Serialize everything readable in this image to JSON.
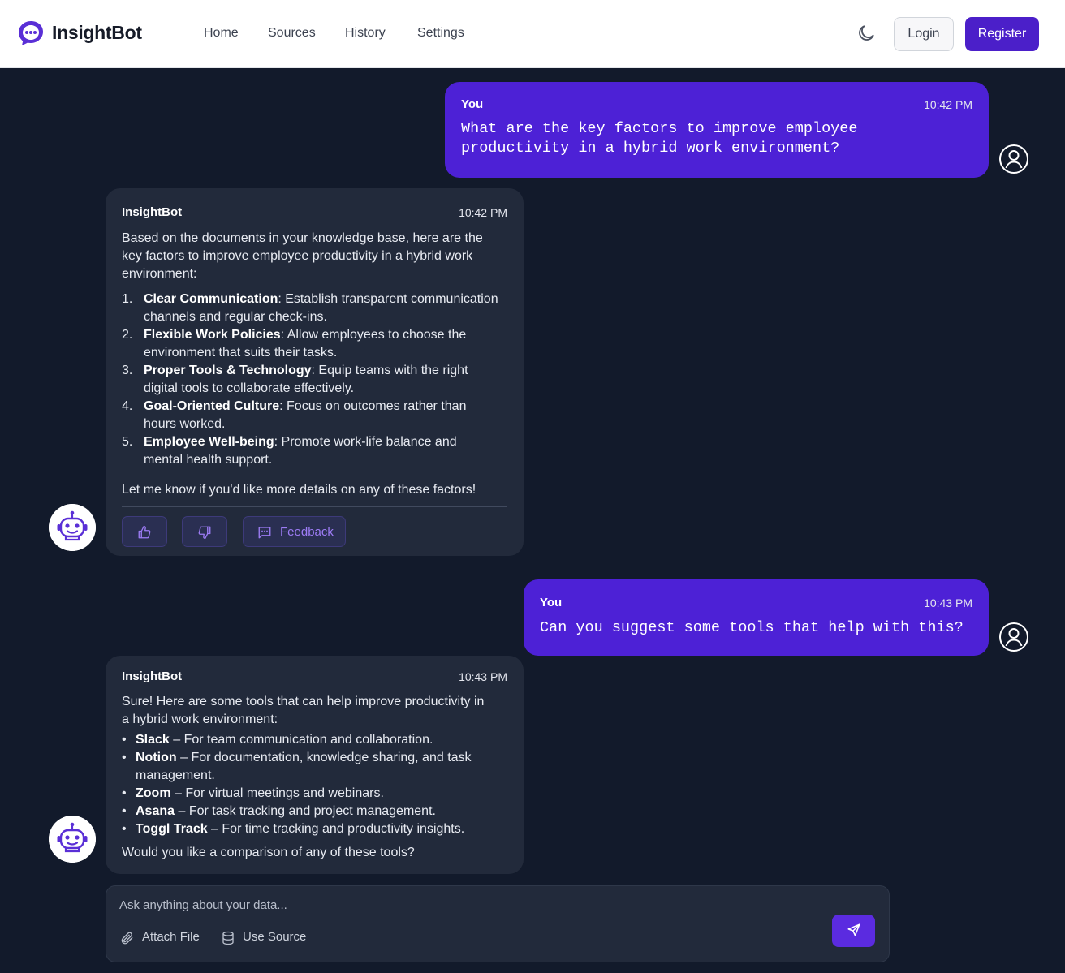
{
  "app": {
    "name": "InsightBot"
  },
  "nav": {
    "items": [
      "Home",
      "Sources",
      "History",
      "Settings"
    ]
  },
  "header": {
    "login_label": "Login",
    "register_label": "Register",
    "theme_icon": "moon-icon"
  },
  "colors": {
    "accent": "#4b1fc9",
    "user_bubble": "#4d21d6",
    "bot_bubble": "#222a3b",
    "background": "#121a2b",
    "link": "#9d7cf5"
  },
  "messages": [
    {
      "sender": "You",
      "time": "10:42 PM",
      "lines": [
        "What are the key factors to improve employee",
        "productivity in a hybrid work environment?"
      ]
    },
    {
      "sender": "InsightBot",
      "time": "10:42 PM",
      "intro_lines": [
        "Based on the documents in your knowledge base, here are the",
        "key factors to improve employee productivity in a hybrid work",
        "environment:"
      ],
      "items": [
        {
          "num": "1.",
          "title": "Clear Communication",
          "line1": ": Establish transparent communication",
          "line2": "channels and regular check-ins."
        },
        {
          "num": "2.",
          "title": "Flexible Work Policies",
          "line1": ": Allow employees to choose the",
          "line2": "environment that suits their tasks."
        },
        {
          "num": "3.",
          "title": "Proper Tools & Technology",
          "line1": ": Equip teams with the right",
          "line2": "digital tools to collaborate effectively."
        },
        {
          "num": "4.",
          "title": "Goal-Oriented Culture",
          "line1": ": Focus on outcomes rather than",
          "line2": "hours worked."
        },
        {
          "num": "5.",
          "title": "Employee Well-being",
          "line1": ": Promote work-life balance and",
          "line2": "mental health support."
        }
      ],
      "outro": "Let me know if you'd like more details on any of these factors!",
      "feedback_label": "Feedback"
    },
    {
      "sender": "You",
      "time": "10:43 PM",
      "lines": [
        "Can you suggest some tools that help with this?"
      ]
    },
    {
      "sender": "InsightBot",
      "time": "10:43 PM",
      "intro_lines": [
        "Sure! Here are some tools that can help improve productivity in",
        "a hybrid work environment:"
      ],
      "items": [
        {
          "bullet": "•",
          "title": "Slack",
          "line1": " – For team communication and collaboration.",
          "line2": ""
        },
        {
          "bullet": "•",
          "title": "Notion",
          "line1": " – For documentation, knowledge sharing, and task",
          "line2": "management."
        },
        {
          "bullet": "•",
          "title": "Zoom",
          "line1": " – For virtual meetings and webinars.",
          "line2": ""
        },
        {
          "bullet": "•",
          "title": "Asana",
          "line1": " – For task tracking and project management.",
          "line2": ""
        },
        {
          "bullet": "•",
          "title": "Toggl Track",
          "line1": " – For time tracking and productivity insights.",
          "line2": ""
        }
      ],
      "outro": "Would you like a comparison of any of these tools?"
    }
  ],
  "composer": {
    "placeholder": "Ask anything about your data...",
    "attach_label": "Attach File",
    "source_label": "Use Source"
  }
}
